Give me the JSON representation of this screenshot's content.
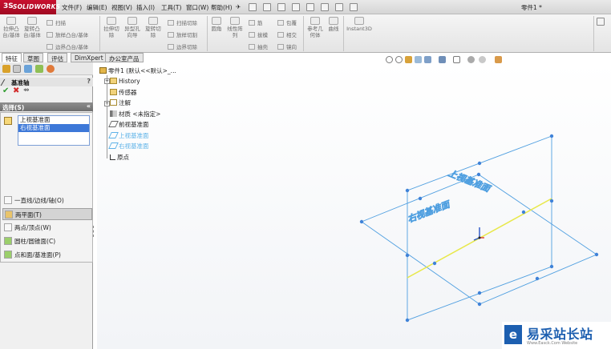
{
  "app": {
    "brand": "SOLIDWORKS",
    "document_title": "零件1 *",
    "menu": [
      "文件(F)",
      "编辑(E)",
      "视图(V)",
      "插入(I)",
      "工具(T)",
      "窗口(W)",
      "帮助(H)"
    ],
    "menu_pin": "✈"
  },
  "ribbon": {
    "big_tools": [
      {
        "label": "拉伸凸台/基体"
      },
      {
        "label": "旋转凸台/基体"
      },
      {
        "label": "拉伸切除"
      },
      {
        "label": "异型孔向导"
      },
      {
        "label": "旋转切除"
      },
      {
        "label": "圆角"
      },
      {
        "label": "线性阵列"
      },
      {
        "label": "参考几何体"
      },
      {
        "label": "曲线"
      },
      {
        "label": "Instant3D"
      }
    ],
    "small_tools": [
      "扫描",
      "放样凸台/基体",
      "边界凸台/基体",
      "扫描切除",
      "放样切割",
      "边界切除",
      "筋",
      "拔模",
      "抽壳",
      "包覆",
      "相交",
      "镜向"
    ]
  },
  "tabs": [
    {
      "label": "特征",
      "active": true
    },
    {
      "label": "草图",
      "active": false
    },
    {
      "label": "评估",
      "active": false
    },
    {
      "label": "DimXpert",
      "active": false
    },
    {
      "label": "办公室产品",
      "active": false
    }
  ],
  "property_manager": {
    "feature_name": "基准轴",
    "help_label": "?",
    "ok_label": "✔",
    "cancel_label": "✖",
    "pin_label": "⇴",
    "selection_header": "选择(S)",
    "collapse_label": "«",
    "selections": [
      "上视基准面",
      "右视基准面"
    ],
    "options": [
      {
        "label": "一直线/边线/轴(O)",
        "selected": false
      },
      {
        "label": "两平面(T)",
        "selected": true
      },
      {
        "label": "两点/顶点(W)",
        "selected": false
      },
      {
        "label": "圆柱/圆锥面(C)",
        "selected": false
      },
      {
        "label": "点和面/基准面(P)",
        "selected": false
      }
    ]
  },
  "feature_tree": {
    "root": "零件1  (默认<<默认>_...",
    "nodes": [
      {
        "label": "History"
      },
      {
        "label": "传感器"
      },
      {
        "label": "注解"
      },
      {
        "label": "材质 <未指定>"
      },
      {
        "label": "前视基准面"
      },
      {
        "label": "上视基准面"
      },
      {
        "label": "右视基准面"
      },
      {
        "label": "原点"
      }
    ]
  },
  "viewport": {
    "plane_labels": [
      "上视基准面",
      "右视基准面"
    ],
    "plane_color": "#4f9fe0",
    "axis_color": "#e8e84a"
  },
  "watermark": {
    "badge": "e",
    "main": "易采站长站",
    "sub": "Www.Easck.Com  Website"
  },
  "colors": {
    "accent_red": "#c8102e",
    "selection_blue": "#3d78d8"
  }
}
